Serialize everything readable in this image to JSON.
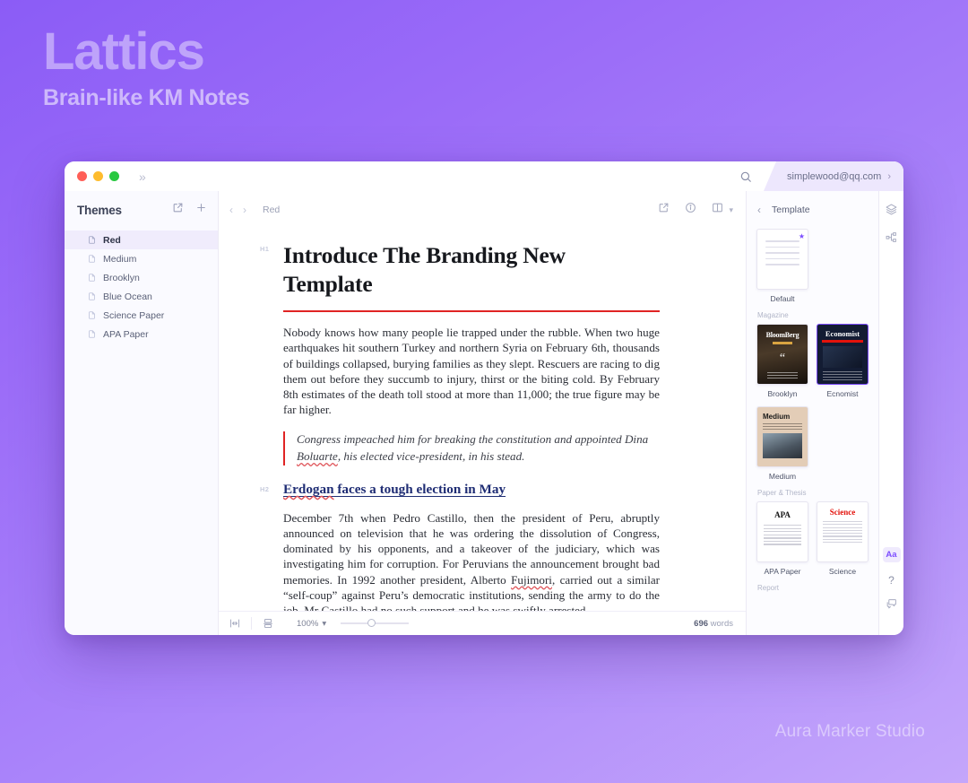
{
  "promo": {
    "title": "Lattics",
    "subtitle": "Brain-like KM Notes",
    "watermark": "Aura Marker Studio"
  },
  "colors": {
    "background_top": "#8b5cf6",
    "background_bottom": "#c4a6fb",
    "accent": "#7c4dff",
    "rule_red": "#e02424",
    "heading_blue": "#1f2d74"
  },
  "titlebar": {
    "expand_icon": "chevron-double-right-icon",
    "search_icon": "search-icon",
    "account_email": "simplewood@qq.com",
    "account_chevron": "chevron-right-icon",
    "traffic_lights": [
      "close",
      "minimize",
      "maximize"
    ]
  },
  "sidebar": {
    "title": "Themes",
    "actions": [
      {
        "icon": "external-link-icon"
      },
      {
        "icon": "plus-icon"
      }
    ],
    "items": [
      {
        "label": "Red",
        "icon": "document-icon",
        "active": true
      },
      {
        "label": "Medium",
        "icon": "document-icon",
        "active": false
      },
      {
        "label": "Brooklyn",
        "icon": "document-icon",
        "active": false
      },
      {
        "label": "Blue Ocean",
        "icon": "document-icon",
        "active": false
      },
      {
        "label": "Science Paper",
        "icon": "document-icon",
        "active": false
      },
      {
        "label": "APA Paper",
        "icon": "document-icon",
        "active": false
      }
    ]
  },
  "editor_toolbar": {
    "back_icon": "chevron-left-icon",
    "forward_icon": "chevron-right-icon",
    "breadcrumb": "Red",
    "actions": [
      {
        "icon": "external-link-icon"
      },
      {
        "icon": "info-circle-icon"
      },
      {
        "icon": "split-view-icon"
      },
      {
        "icon": "chevron-down-icon"
      }
    ]
  },
  "document": {
    "title": "Introduce The Branding New Template",
    "title_gutter_tag": "H1",
    "paragraph_1": "Nobody knows how many people lie trapped under the rubble. When two huge earthquakes hit southern Turkey and northern Syria on February 6th, thousands of buildings collapsed, burying families as they slept. Rescuers are racing to dig them out before they succumb to injury, thirst or the biting cold. By February 8th estimates of the death toll stood at more than 11,000; the true figure may be far higher.",
    "quote_part_1": "Congress impeached him for breaking the constitution and appointed Dina ",
    "quote_misspelled": "Boluarte",
    "quote_part_2": ", his elected vice-president, in his stead.",
    "heading_2_misspelled": "Erdogan",
    "heading_2_rest": " faces a tough election in May",
    "heading_2_gutter_tag": "H2",
    "paragraph_2_part_1": "December 7th when Pedro Castillo, then the president of Peru, abruptly announced on television that he was ordering the dissolution of Congress, dominated by his opponents, and a takeover of the judiciary, which was investigating him for corruption. For Peruvians the announcement brought bad memories. In 1992 another president, Alberto ",
    "paragraph_2_misspelled": "Fujimori",
    "paragraph_2_part_2": ", carried out a similar “self-coup” against Peru’s democratic institutions, sending the army to do the job. Mr Castillo had no such support and he was swiftly arrested."
  },
  "statusbar": {
    "focus_icon": "focus-mode-icon",
    "typewriter_icon": "typewriter-mode-icon",
    "zoom_value": "100%",
    "zoom_caret": "chevron-down-icon",
    "word_count": "696",
    "word_label": "words"
  },
  "template_panel": {
    "back_icon": "chevron-left-icon",
    "title": "Template",
    "groups": [
      {
        "label": "",
        "cards": [
          {
            "name": "Default",
            "art": "default",
            "selected": false,
            "starred": true
          }
        ]
      },
      {
        "label": "Magazine",
        "cards": [
          {
            "name": "Brooklyn",
            "art": "bloomberg",
            "selected": false,
            "starred": false
          },
          {
            "name": "Ecnomist",
            "art": "economist",
            "selected": true,
            "starred": false
          },
          {
            "name": "Medium",
            "art": "medium",
            "selected": false,
            "starred": false
          }
        ]
      },
      {
        "label": "Paper & Thesis",
        "cards": [
          {
            "name": "APA Paper",
            "art": "apa",
            "selected": false,
            "starred": false
          },
          {
            "name": "Science",
            "art": "science",
            "selected": false,
            "starred": false
          }
        ]
      },
      {
        "label": "Report",
        "cards": []
      }
    ],
    "thumb_text": {
      "bloomberg": "BloomBerg",
      "economist": "Economist",
      "medium": "Medium",
      "apa": "APA",
      "science": "Science"
    }
  },
  "rail": {
    "top_icons": [
      {
        "icon": "layers-icon"
      },
      {
        "icon": "share-nodes-icon"
      }
    ],
    "aa_label": "Aa",
    "help_label": "?",
    "comment_icon": "comment-icon"
  }
}
